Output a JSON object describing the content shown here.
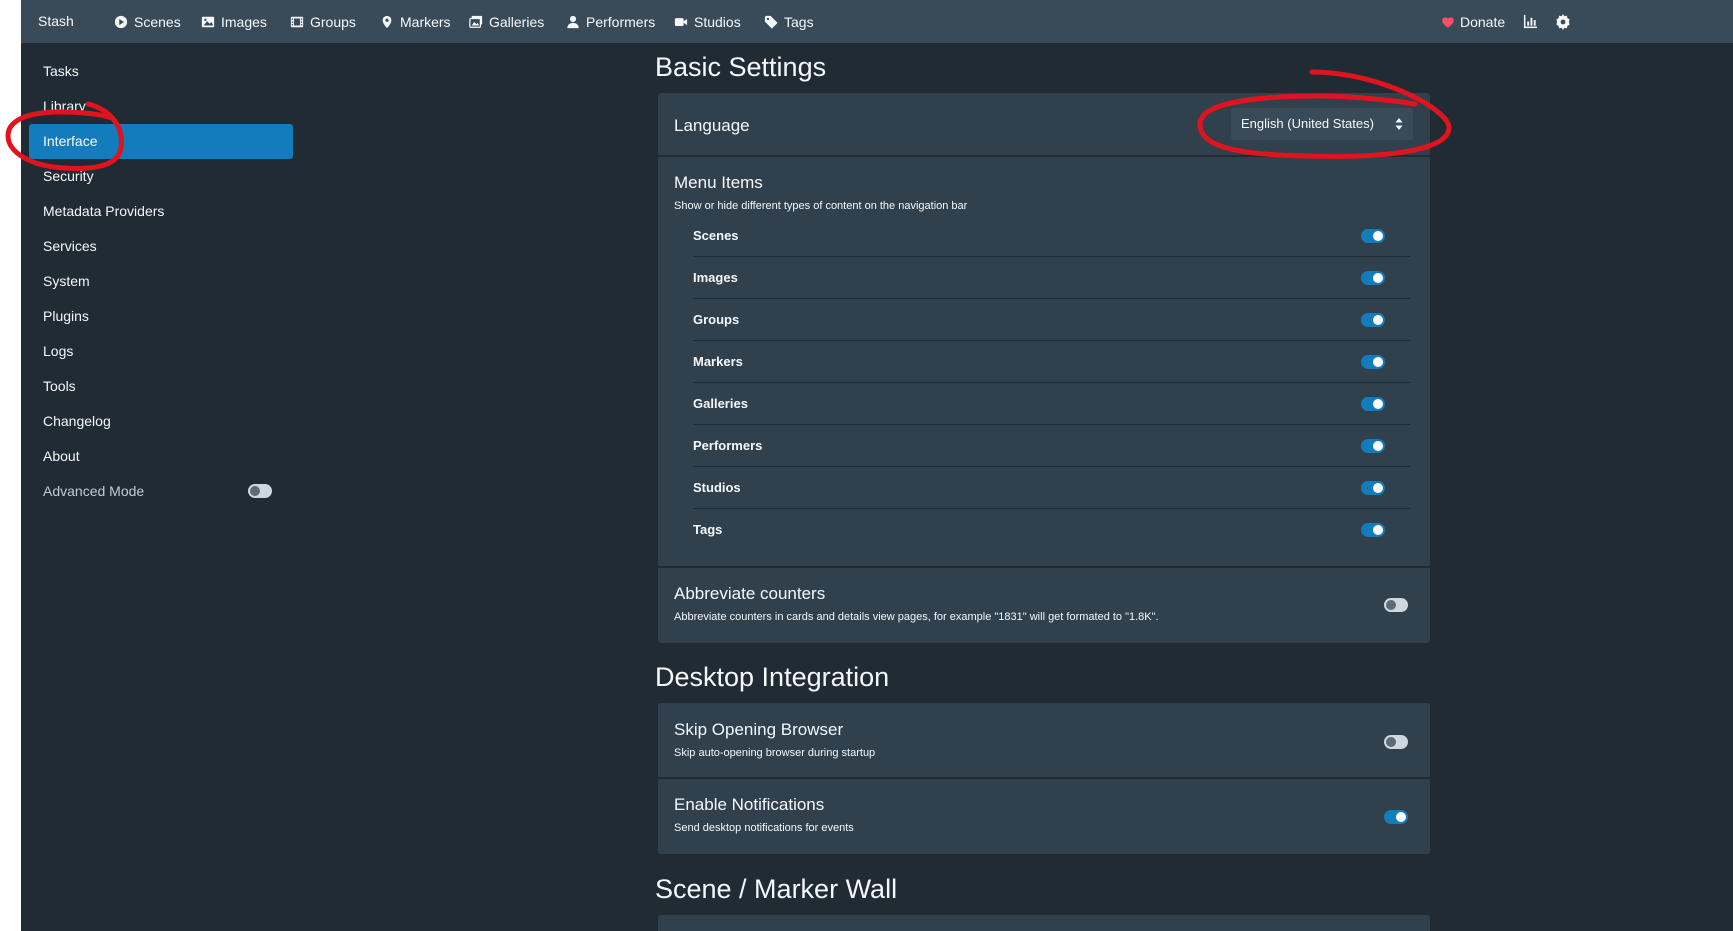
{
  "nav": {
    "brand": "Stash",
    "items": [
      {
        "label": "Scenes",
        "icon": "play-circle-icon"
      },
      {
        "label": "Images",
        "icon": "image-icon"
      },
      {
        "label": "Groups",
        "icon": "film-icon"
      },
      {
        "label": "Markers",
        "icon": "map-marker-icon"
      },
      {
        "label": "Galleries",
        "icon": "images-icon"
      },
      {
        "label": "Performers",
        "icon": "user-icon"
      },
      {
        "label": "Studios",
        "icon": "video-icon"
      },
      {
        "label": "Tags",
        "icon": "tag-icon"
      }
    ],
    "donate": "Donate",
    "stats_icon": "chart-bar-icon",
    "settings_icon": "gear-icon"
  },
  "sidebar": {
    "items": [
      "Tasks",
      "Library",
      "Interface",
      "Security",
      "Metadata Providers",
      "Services",
      "System",
      "Plugins",
      "Logs",
      "Tools",
      "Changelog",
      "About"
    ],
    "active": "Interface",
    "advanced_mode": {
      "label": "Advanced Mode",
      "enabled": false
    }
  },
  "basic": {
    "title": "Basic Settings",
    "language": {
      "label": "Language",
      "value": "English (United States)"
    },
    "menu": {
      "title": "Menu Items",
      "description": "Show or hide different types of content on the navigation bar",
      "items": [
        {
          "label": "Scenes",
          "enabled": true
        },
        {
          "label": "Images",
          "enabled": true
        },
        {
          "label": "Groups",
          "enabled": true
        },
        {
          "label": "Markers",
          "enabled": true
        },
        {
          "label": "Galleries",
          "enabled": true
        },
        {
          "label": "Performers",
          "enabled": true
        },
        {
          "label": "Studios",
          "enabled": true
        },
        {
          "label": "Tags",
          "enabled": true
        }
      ]
    },
    "abbreviate": {
      "title": "Abbreviate counters",
      "description": "Abbreviate counters in cards and details view pages, for example \"1831\" will get formated to \"1.8K\".",
      "enabled": false
    }
  },
  "desktop": {
    "title": "Desktop Integration",
    "skip_browser": {
      "title": "Skip Opening Browser",
      "description": "Skip auto-opening browser during startup",
      "enabled": false
    },
    "notifications": {
      "title": "Enable Notifications",
      "description": "Send desktop notifications for events",
      "enabled": true
    }
  },
  "wall": {
    "title": "Scene / Marker Wall"
  },
  "colors": {
    "nav_bg": "#394b59",
    "page_bg": "#202b33",
    "card_bg": "#30404d",
    "accent": "#137cbd",
    "donate_heart": "#ff4d6a",
    "annotation": "#e0141e"
  }
}
